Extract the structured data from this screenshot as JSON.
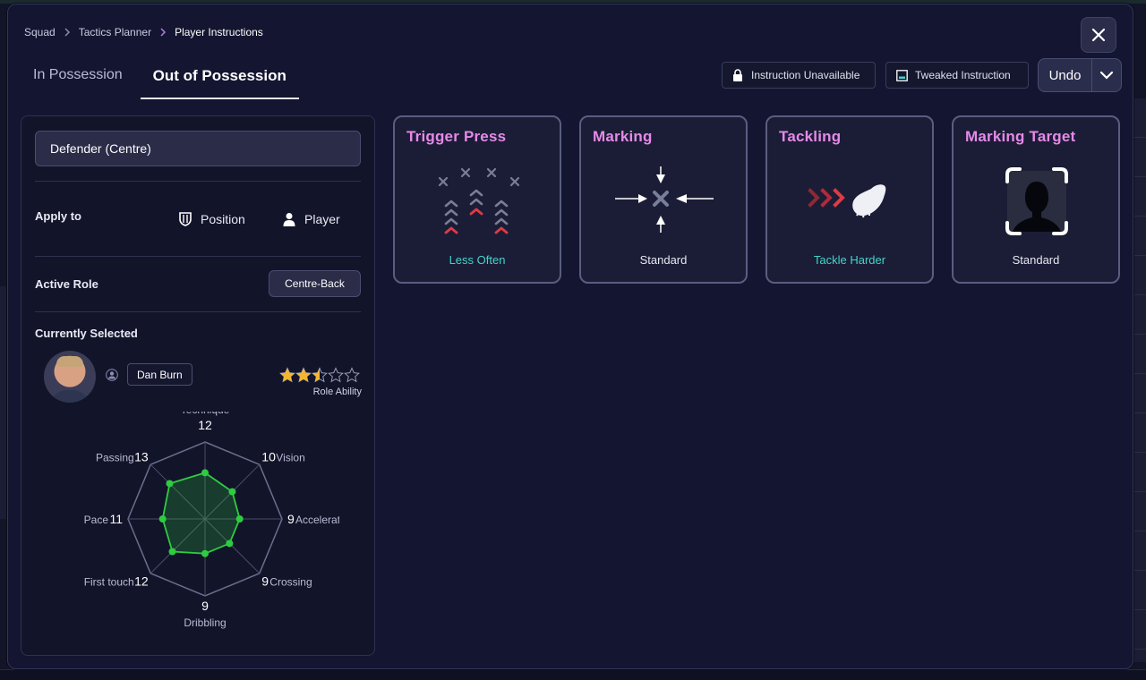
{
  "breadcrumb": [
    "Squad",
    "Tactics Planner",
    "Player Instructions"
  ],
  "tabs": [
    {
      "label": "In Possession",
      "active": false
    },
    {
      "label": "Out of Possession",
      "active": true
    }
  ],
  "legend": {
    "unavailable": "Instruction Unavailable",
    "tweaked": "Tweaked Instruction"
  },
  "undo_label": "Undo",
  "left_panel": {
    "role_select": "Defender (Centre)",
    "apply_to_label": "Apply to",
    "apply_options": [
      "Position",
      "Player"
    ],
    "active_role_label": "Active Role",
    "active_role_value": "Centre-Back",
    "currently_selected_label": "Currently Selected",
    "player_name": "Dan Burn",
    "role_ability_label": "Role Ability",
    "role_ability_stars": 2.5,
    "role_ability_max": 5,
    "attributes": [
      {
        "name": "Technique",
        "value": "12"
      },
      {
        "name": "Vision",
        "value": "10"
      },
      {
        "name": "Acceleration",
        "value": "9"
      },
      {
        "name": "Crossing",
        "value": "9"
      },
      {
        "name": "Dribbling",
        "value": "9"
      },
      {
        "name": "First touch",
        "value": "12"
      },
      {
        "name": "Pace",
        "value": "11"
      },
      {
        "name": "Passing",
        "value": "13"
      }
    ]
  },
  "instructions": [
    {
      "title": "Trigger Press",
      "value": "Less Often",
      "tweaked": true,
      "icon": "trigger-press-icon"
    },
    {
      "title": "Marking",
      "value": "Standard",
      "tweaked": false,
      "icon": "marking-icon"
    },
    {
      "title": "Tackling",
      "value": "Tackle Harder",
      "tweaked": true,
      "icon": "tackling-icon"
    },
    {
      "title": "Marking Target",
      "value": "Standard",
      "tweaked": false,
      "icon": "marking-target-icon"
    }
  ],
  "colors": {
    "accent_pink": "#e58ae8",
    "tweaked_teal": "#46d3c9",
    "radar_green": "#2ecc40",
    "star_gold": "#f2b630"
  }
}
